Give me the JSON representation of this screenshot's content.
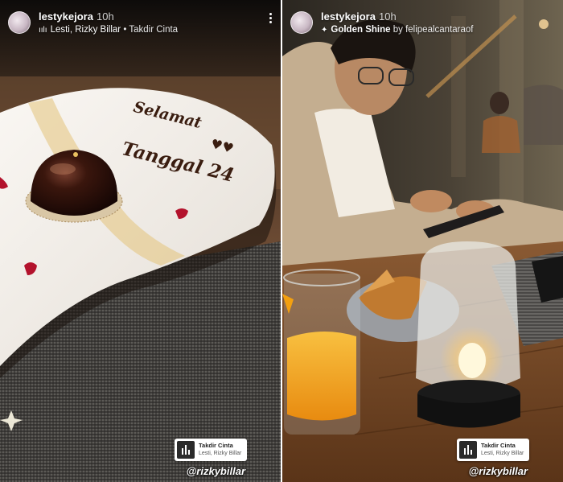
{
  "stories": [
    {
      "username": "lestykejora",
      "time": "10h",
      "music_icon": "soundwave-icon",
      "music_artist": "Lesti, Rizky Billar",
      "music_sep": "•",
      "music_title": "Takdir Cinta",
      "plate_line1": "Selamat",
      "plate_line2": "Tanggal 24",
      "sticker_title": "Takdir Cinta",
      "sticker_artist": "Lesti, Rizky Billar",
      "mention": "@rizkybillar"
    },
    {
      "username": "lestykejora",
      "time": "10h",
      "music_icon": "sparkle-icon",
      "music_title": "Golden Shine",
      "music_by": "by",
      "music_artist": "felipealcantaraof",
      "sticker_title": "Takdir Cinta",
      "sticker_artist": "Lesti, Rizky Billar",
      "mention": "@rizkybillar"
    }
  ],
  "colors": {
    "text": "#ffffff",
    "plate": "#f1ece6",
    "dessert": "#2a120a",
    "juice": "#f2a21c",
    "candle": "#f8e7b8"
  }
}
